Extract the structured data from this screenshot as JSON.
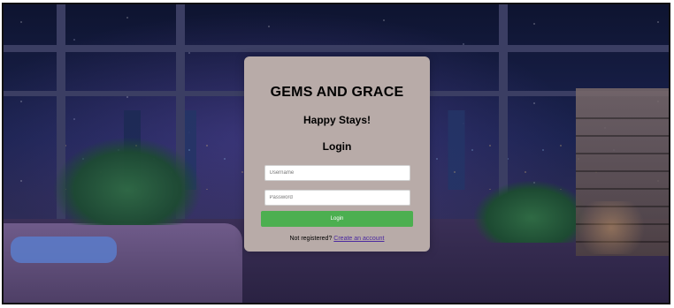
{
  "brand": {
    "title": "GEMS AND GRACE",
    "tagline": "Happy Stays!"
  },
  "login": {
    "heading": "Login",
    "username_placeholder": "Username",
    "password_placeholder": "Password",
    "submit_label": "Login",
    "register_prompt": "Not registered?",
    "register_link": "Create an account"
  },
  "colors": {
    "card_background": "#b8aba8",
    "button": "#4caf50",
    "link": "#4b2aa0"
  }
}
